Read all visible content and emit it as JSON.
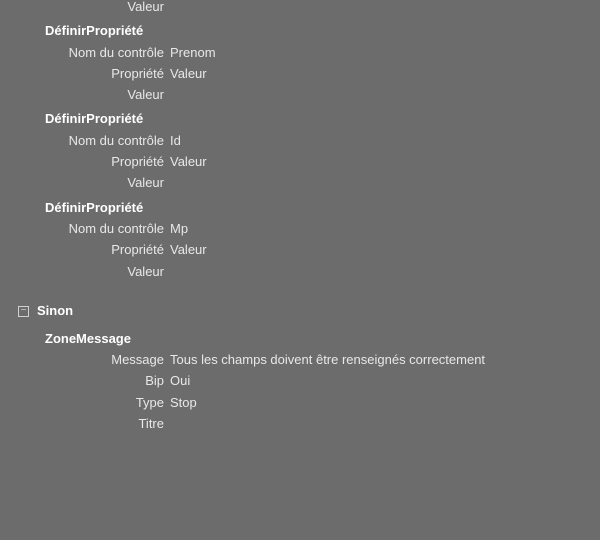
{
  "partial_label": "Valeur",
  "definir_label": "DéfinirPropriété",
  "field_labels": {
    "control_name": "Nom du contrôle",
    "property": "Propriété",
    "value": "Valeur"
  },
  "blocks": [
    {
      "control_name": "Prenom",
      "property": "Valeur",
      "value": ""
    },
    {
      "control_name": "Id",
      "property": "Valeur",
      "value": ""
    },
    {
      "control_name": "Mp",
      "property": "Valeur",
      "value": ""
    }
  ],
  "else_label": "Sinon",
  "zone_message": {
    "title": "ZoneMessage",
    "labels": {
      "message": "Message",
      "bip": "Bip",
      "type": "Type",
      "titre": "Titre"
    },
    "message": "Tous les champs doivent être renseignés correctement",
    "bip": "Oui",
    "type": "Stop",
    "titre": ""
  }
}
